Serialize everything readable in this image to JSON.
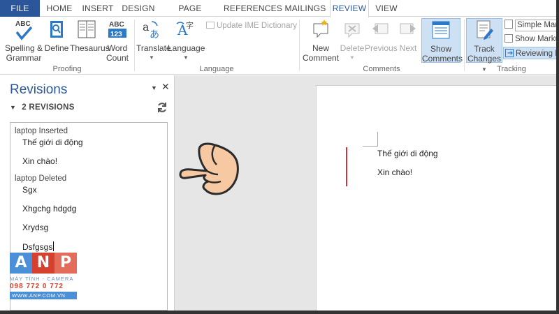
{
  "tabs": [
    "FILE",
    "HOME",
    "INSERT",
    "DESIGN",
    "PAGE LAYOUT",
    "REFERENCES",
    "MAILINGS",
    "REVIEW",
    "VIEW"
  ],
  "active_tab": "REVIEW",
  "ribbon": {
    "proofing": {
      "label": "Proofing",
      "spelling": {
        "line1": "Spelling &",
        "line2": "Grammar",
        "icon": "abc-check-icon"
      },
      "define": {
        "label": "Define",
        "icon": "book-search-icon"
      },
      "thesaurus": {
        "label": "Thesaurus",
        "icon": "thesaurus-icon"
      },
      "word_count": {
        "line1": "Word",
        "line2": "Count",
        "icon": "abc-123-icon"
      }
    },
    "language": {
      "label": "Language",
      "translate": {
        "label": "Translate",
        "icon": "translate-icon"
      },
      "language": {
        "label": "Language",
        "icon": "language-icon"
      },
      "ime": "Update IME Dictionary"
    },
    "comments": {
      "label": "Comments",
      "new_comment": {
        "line1": "New",
        "line2": "Comment"
      },
      "delete": "Delete",
      "previous": "Previous",
      "next": "Next",
      "show_comments": {
        "line1": "Show",
        "line2": "Comments"
      }
    },
    "tracking": {
      "label": "Tracking",
      "track_changes": {
        "line1": "Track",
        "line2": "Changes"
      },
      "markup_select": "Simple Mar",
      "show_markup": "Show Marku",
      "reviewing_pane": "Reviewing P"
    }
  },
  "revisions": {
    "title": "Revisions",
    "count_label": "2 REVISIONS",
    "entries": [
      {
        "author_line": "laptop Inserted",
        "lines": [
          "Thế giới di động",
          "Xin chào!"
        ]
      },
      {
        "author_line": "laptop Deleted",
        "lines": [
          "Sgx",
          "Xhgchg  hdgdg",
          "Xrydsg",
          "Dsfgsgs"
        ]
      }
    ]
  },
  "document": {
    "lines": [
      "Thế giới di động",
      "Xin chào!"
    ],
    "change_bar_color": "#d13438"
  },
  "logo": {
    "letters": [
      "A",
      "N",
      "P"
    ],
    "letter_colors": [
      "#4a8fd8",
      "#d6402e",
      "#e36c5a"
    ],
    "tagline": "MÁY TÍNH - CAMERA",
    "phone": "098 772 0 772",
    "website": "WWW.ANP.COM.VN"
  },
  "colors": {
    "accent": "#2b579a",
    "pressed": "#cde0f4"
  }
}
